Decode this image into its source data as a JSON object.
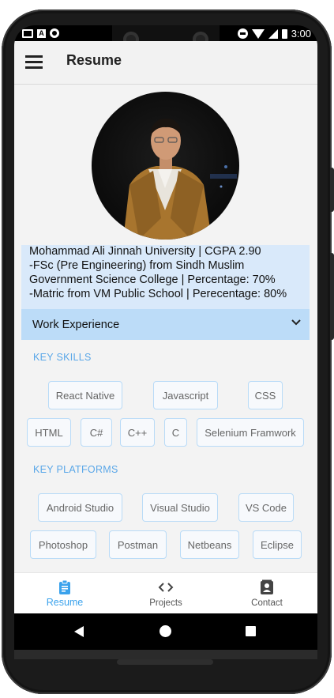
{
  "statusbar": {
    "time": "3:00"
  },
  "appbar": {
    "title": "Resume"
  },
  "education": {
    "lines": [
      "Mohammad Ali Jinnah University | CGPA 2.90",
      "-FSc (Pre Engineering) from Sindh Muslim",
      "Government Science College | Percentage: 70%",
      "-Matric from VM Public School | Perecentage: 80%"
    ]
  },
  "accordion": {
    "label": "Work Experience"
  },
  "key_skills": {
    "title": "KEY SKILLS",
    "chips": [
      "React Native",
      "Javascript",
      "CSS",
      "HTML",
      "C#",
      "C++",
      "C",
      "Selenium Framwork"
    ]
  },
  "key_platforms": {
    "title": "KEY PLATFORMS",
    "chips": [
      "Android Studio",
      "Visual Studio",
      "VS Code",
      "Photoshop",
      "Postman",
      "Netbeans",
      "Eclipse"
    ]
  },
  "bottom_nav": {
    "items": [
      {
        "label": "Resume",
        "icon": "clipboard-icon",
        "active": true
      },
      {
        "label": "Projects",
        "icon": "code-icon",
        "active": false
      },
      {
        "label": "Contact",
        "icon": "contact-card-icon",
        "active": false
      }
    ]
  },
  "colors": {
    "accent": "#3aa2ec",
    "chip_border": "#b9dbf7",
    "education_bg": "#d9e9fa",
    "accordion_bg": "#bcdcf8"
  }
}
